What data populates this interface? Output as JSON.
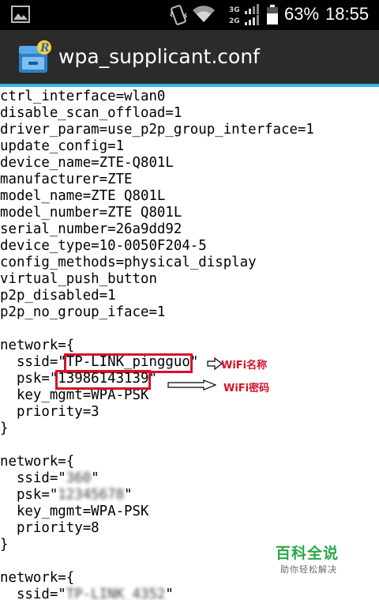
{
  "status_bar": {
    "network_top": "3G",
    "network_bottom": "2G",
    "battery_percent": "63%",
    "time": "18:55",
    "icons": [
      "gallery-icon",
      "vibrate-icon",
      "wifi-icon",
      "signal-icon",
      "battery-icon"
    ]
  },
  "app": {
    "title": "wpa_supplicant.conf",
    "icon_letter": "R",
    "accent_color": "#33b5e5",
    "highlight_color": "#d8102a"
  },
  "file": {
    "lines": [
      "ctrl_interface=wlan0",
      "disable_scan_offload=1",
      "driver_param=use_p2p_group_interface=1",
      "update_config=1",
      "device_name=ZTE-Q801L",
      "manufacturer=ZTE",
      "model_name=ZTE Q801L",
      "model_number=ZTE Q801L",
      "serial_number=26a9dd92",
      "device_type=10-0050F204-5",
      "config_methods=physical_display",
      "virtual_push_button",
      "p2p_disabled=1",
      "p2p_no_group_iface=1",
      "",
      "network={",
      "  ssid=\"TP-LINK_pingguo\"",
      "  psk=\"13986143139\"",
      "  key_mgmt=WPA-PSK",
      "  priority=3",
      "}",
      "",
      "network={",
      "  ssid=\"360\"",
      "  psk=\"12345678\"",
      "  key_mgmt=WPA-PSK",
      "  priority=8",
      "}",
      "",
      "network={",
      "  ssid=\"TP-LINK_4352\""
    ],
    "network1": {
      "ssid_prefix": "  ssid=\"",
      "ssid_value": "TP-LINK_pingguo",
      "ssid_suffix": "\"",
      "psk_prefix": "  psk=\"",
      "psk_value": "13986143139",
      "psk_suffix": "\""
    },
    "network2": {
      "ssid_prefix": "  ssid=\"",
      "ssid_value": "360",
      "ssid_suffix": "\"",
      "psk_prefix": "  psk=\"",
      "psk_value": "12345678",
      "psk_suffix": "\""
    },
    "network3": {
      "ssid_prefix": "  ssid=\"",
      "ssid_value": "TP-LINK_4352",
      "ssid_suffix": "\""
    }
  },
  "annotations": {
    "ssid_label": "WiFi名称",
    "psk_label": "WiFi密码"
  },
  "watermark": {
    "title": "百科全说",
    "subtitle": "助你轻松解决"
  }
}
